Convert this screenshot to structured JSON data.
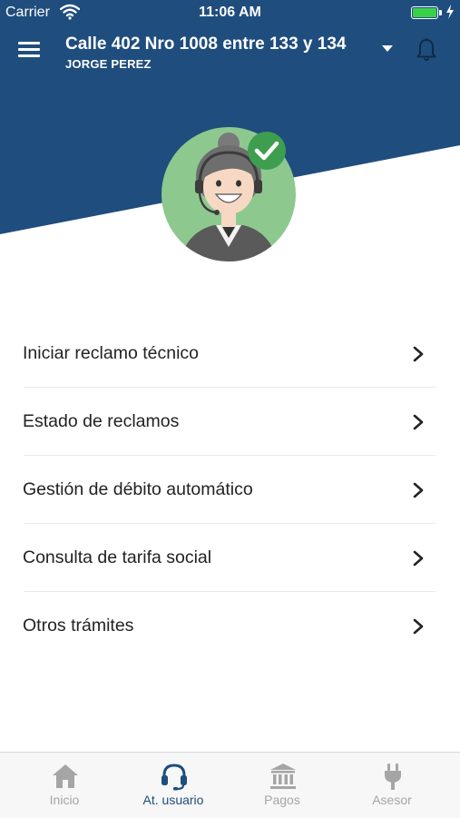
{
  "status_bar": {
    "carrier": "Carrier",
    "time": "11:06 AM",
    "battery_percent": 100
  },
  "header": {
    "address": "Calle 402 Nro 1008 entre 133 y 134",
    "user_name": "JORGE PEREZ"
  },
  "colors": {
    "primary": "#1f4d7d",
    "avatar_bg": "#8dc98f",
    "check_badge": "#3e9e4f",
    "tab_inactive": "#a5a5a5",
    "battery": "#3ad14a"
  },
  "menu": {
    "items": [
      {
        "label": "Iniciar reclamo técnico",
        "icon": "chevron-right-icon"
      },
      {
        "label": "Estado de reclamos",
        "icon": "chevron-right-icon"
      },
      {
        "label": "Gestión de débito automático",
        "icon": "chevron-right-icon"
      },
      {
        "label": "Consulta de tarifa social",
        "icon": "chevron-right-icon"
      },
      {
        "label": "Otros trámites",
        "icon": "chevron-right-icon"
      }
    ]
  },
  "tabs": [
    {
      "label": "Inicio",
      "icon": "home-icon",
      "active": false
    },
    {
      "label": "At. usuario",
      "icon": "headset-icon",
      "active": true
    },
    {
      "label": "Pagos",
      "icon": "bank-icon",
      "active": false
    },
    {
      "label": "Asesor",
      "icon": "plug-icon",
      "active": false
    }
  ]
}
